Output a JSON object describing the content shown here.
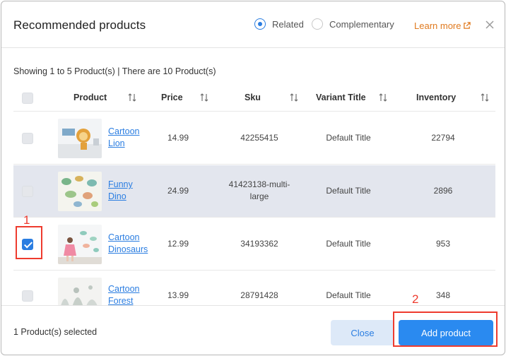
{
  "header": {
    "title": "Recommended products",
    "radio_related": "Related",
    "radio_complementary": "Complementary",
    "learn_more": "Learn more"
  },
  "summary": "Showing 1 to 5 Product(s) | There are 10 Product(s)",
  "columns": {
    "product": "Product",
    "price": "Price",
    "sku": "Sku",
    "variant": "Variant Title",
    "inventory": "Inventory"
  },
  "rows": [
    {
      "name_line1": "Cartoon",
      "name_line2": "Lion",
      "price": "14.99",
      "sku_line1": "42255415",
      "sku_line2": "",
      "variant": "Default Title",
      "inventory": "22794",
      "checked": false,
      "highlighted": false
    },
    {
      "name_line1": "Funny",
      "name_line2": "Dino",
      "price": "24.99",
      "sku_line1": "41423138-multi-",
      "sku_line2": "large",
      "variant": "Default Title",
      "inventory": "2896",
      "checked": false,
      "highlighted": true
    },
    {
      "name_line1": "Cartoon",
      "name_line2": "Dinosaurs",
      "price": "12.99",
      "sku_line1": "34193362",
      "sku_line2": "",
      "variant": "Default Title",
      "inventory": "953",
      "checked": true,
      "highlighted": false
    },
    {
      "name_line1": "Cartoon",
      "name_line2": "Forest",
      "price": "13.99",
      "sku_line1": "28791428",
      "sku_line2": "",
      "variant": "Default Title",
      "inventory": "348",
      "checked": false,
      "highlighted": false
    }
  ],
  "footer": {
    "selected_text": "1 Product(s) selected",
    "close_label": "Close",
    "add_label": "Add product"
  },
  "annotations": {
    "one": "1",
    "two": "2"
  },
  "colors": {
    "accent": "#2a7de1",
    "learn_more": "#e07a1f",
    "annotation": "#ee3b2e",
    "highlight_row": "#e3e6ee"
  }
}
